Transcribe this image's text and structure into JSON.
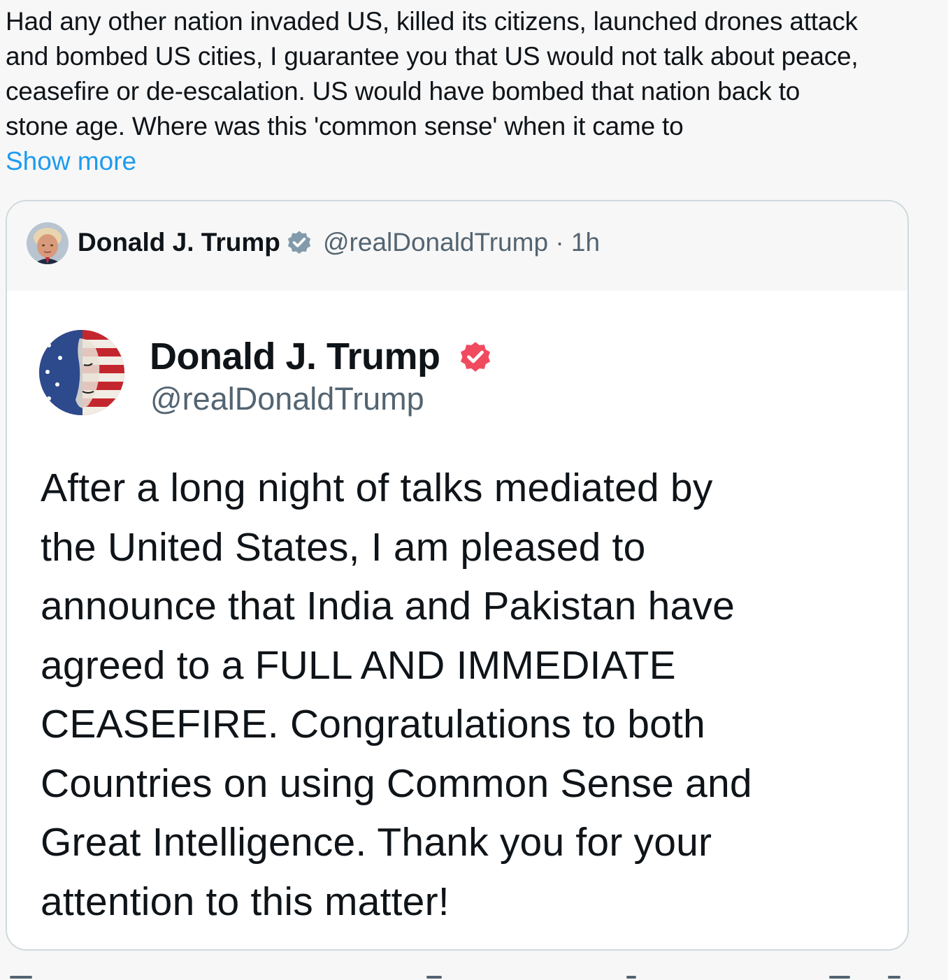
{
  "tweet": {
    "text": "Had any other nation invaded US, killed its citizens, launched drones attack\nand bombed US cities, I guarantee you that US would not talk about peace,\nceasefire or de-escalation. US would have bombed that nation back to\nstone age.  Where was this 'common sense' when it came to",
    "show_more_label": "Show more"
  },
  "quote": {
    "author_name": "Donald J. Trump",
    "handle_time": "@realDonaldTrump · 1h",
    "avatar_icon": "user-avatar",
    "verified_icon": "verified-badge-icon",
    "verified_color": "#829aab",
    "embed": {
      "author_name": "Donald J. Trump",
      "handle": "@realDonaldTrump",
      "verified_color": "#f04a5f",
      "body": "After a long night of talks mediated by\nthe United States, I am pleased to\nannounce that India and Pakistan have\nagreed to a FULL AND IMMEDIATE\nCEASEFIRE. Congratulations to both\nCountries on using Common Sense and\nGreat Intelligence. Thank you for your\nattention to this matter!"
    }
  }
}
